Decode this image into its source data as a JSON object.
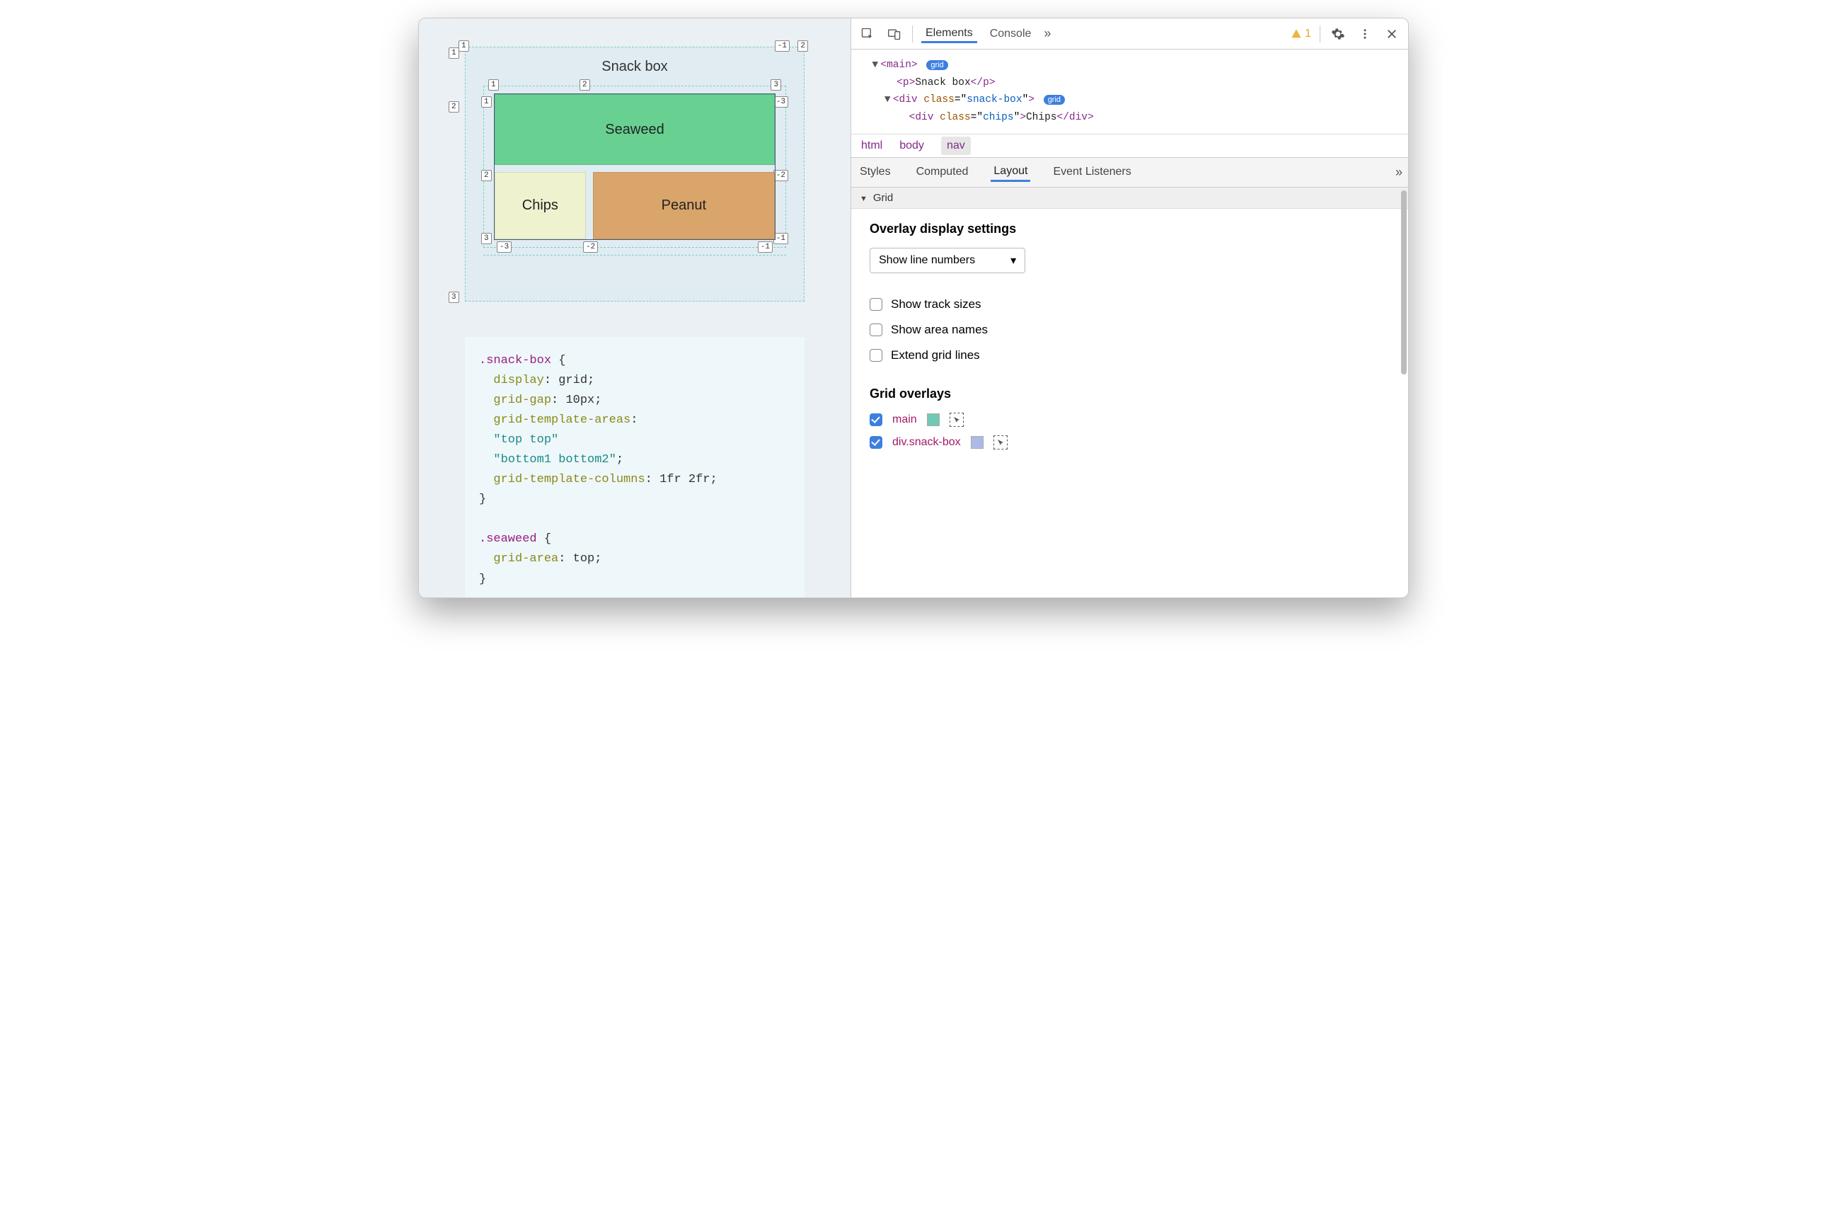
{
  "page": {
    "title": "Snack box",
    "snack": {
      "seaweed": "Seaweed",
      "chips": "Chips",
      "peanut": "Peanut"
    },
    "overlay_labels": {
      "outer_top_left_col": "1",
      "outer_top_right_col_neg": "-1",
      "outer_top_right_col2": "2",
      "outer_row1": "1",
      "outer_row2": "2",
      "outer_row3": "3",
      "inner_c1": "1",
      "inner_c2": "2",
      "inner_c3": "3",
      "inner_c_neg3": "-3",
      "inner_c_neg2": "-2",
      "inner_c_neg1": "-1",
      "inner_r1": "1",
      "inner_r2": "2",
      "inner_r3": "3",
      "inner_r_neg3": "-3",
      "inner_r_neg2": "-2",
      "inner_r_neg1": "-1"
    },
    "css": {
      "sel1": ".snack-box",
      "p_display": "display",
      "v_display": "grid",
      "p_gap": "grid-gap",
      "v_gap": "10px",
      "p_areas": "grid-template-areas",
      "v_areas1": "\"top top\"",
      "v_areas2": "\"bottom1 bottom2\"",
      "p_cols": "grid-template-columns",
      "v_cols": "1fr 2fr",
      "sel2": ".seaweed",
      "p_area": "grid-area",
      "v_area": "top"
    }
  },
  "devtools": {
    "main_tabs": {
      "elements": "Elements",
      "console": "Console"
    },
    "warning_count": "1",
    "dom": {
      "l1a": "<",
      "l1b": "main",
      "l1c": ">",
      "badge_grid": "grid",
      "l2a": "<",
      "l2b": "p",
      "l2c": ">",
      "l2d": "Snack box",
      "l2e": "</",
      "l2f": ">",
      "l3a": "<",
      "l3b": "div",
      "l3c": " ",
      "l3attr": "class",
      "l3eq": "=\"",
      "l3val": "snack-box",
      "l3cq": "\"",
      "l3d": ">",
      "l4a": "<",
      "l4b": "div",
      "l4attr": "class",
      "l4eq": "=\"",
      "l4val": "chips",
      "l4cq": "\"",
      "l4c": ">",
      "l4d": "Chips",
      "l4e": "</",
      "l4f": ">"
    },
    "breadcrumb": {
      "html": "html",
      "body": "body",
      "nav": "nav"
    },
    "subtabs": {
      "styles": "Styles",
      "computed": "Computed",
      "layout": "Layout",
      "events": "Event Listeners"
    },
    "grid_section": "Grid",
    "overlay_settings": {
      "heading": "Overlay display settings",
      "dropdown": "Show line numbers",
      "cb1": "Show track sizes",
      "cb2": "Show area names",
      "cb3": "Extend grid lines"
    },
    "grid_overlays": {
      "heading": "Grid overlays",
      "item1": {
        "label": "main",
        "swatch": "#6fc9b4"
      },
      "item2": {
        "label": "div.snack-box",
        "swatch": "#adb9e6"
      }
    }
  }
}
